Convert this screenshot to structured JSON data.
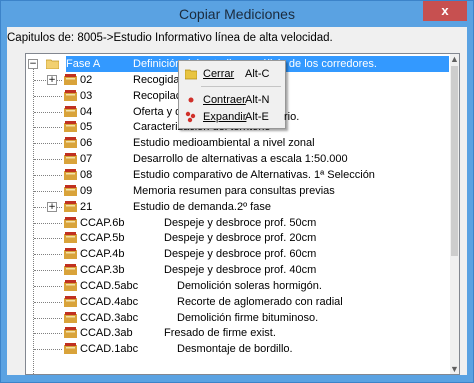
{
  "window": {
    "title": "Copiar Mediciones",
    "close_label": "x"
  },
  "caption": "Capitulos de: 8005->Estudio Informativo línea de alta velocidad.",
  "tree": [
    {
      "code": "Fase A",
      "desc": "Definición del estudio y análisis de los corredores.",
      "level": 0,
      "expander": "−",
      "icon": "folder",
      "selected": true
    },
    {
      "code": "02",
      "desc": "Recogida y",
      "level": 1,
      "expander": "+",
      "icon": "book"
    },
    {
      "code": "03",
      "desc": "Recopilació",
      "level": 1,
      "icon": "book"
    },
    {
      "code": "04",
      "desc": "Oferta y de",
      "level": 1,
      "icon": "book"
    },
    {
      "code": "05",
      "desc": "Caracterización del territorio",
      "level": 1,
      "icon": "book"
    },
    {
      "code": "06",
      "desc": "Estudio medioambiental a nivel zonal",
      "level": 1,
      "icon": "book"
    },
    {
      "code": "07",
      "desc": "Desarrollo de alternativas a escala 1:50.000",
      "level": 1,
      "icon": "book"
    },
    {
      "code": "08",
      "desc": "Estudio comparativo de Alternativas. 1ª Selección",
      "level": 1,
      "icon": "book"
    },
    {
      "code": "09",
      "desc": "Memoria resumen para consultas previas",
      "level": 1,
      "icon": "book"
    },
    {
      "code": "21",
      "desc": "Estudio de demanda.2º fase",
      "level": 1,
      "expander": "+",
      "icon": "book"
    },
    {
      "code": "CCAP.6b",
      "desc": "Despeje y desbroce prof. 50cm",
      "level": 1,
      "icon": "book",
      "indent": 1
    },
    {
      "code": "CCAP.5b",
      "desc": "Despeje y desbroce prof. 20cm",
      "level": 1,
      "icon": "book",
      "indent": 1
    },
    {
      "code": "CCAP.4b",
      "desc": "Despeje y desbroce prof. 60cm",
      "level": 1,
      "icon": "book",
      "indent": 1
    },
    {
      "code": "CCAP.3b",
      "desc": "Despeje y desbroce prof. 40cm",
      "level": 1,
      "icon": "book",
      "indent": 1
    },
    {
      "code": "CCAD.5abc",
      "desc": "Demolición soleras hormigón.",
      "level": 1,
      "icon": "book",
      "indent": 2
    },
    {
      "code": "CCAD.4abc",
      "desc": "Recorte de aglomerado con radial",
      "level": 1,
      "icon": "book",
      "indent": 2
    },
    {
      "code": "CCAD.3abc",
      "desc": "Demolición firme bituminoso.",
      "level": 1,
      "icon": "book",
      "indent": 2
    },
    {
      "code": "CCAD.3ab",
      "desc": "Fresado de firme exist.",
      "level": 1,
      "icon": "book",
      "indent": 1
    },
    {
      "code": "CCAD.1abc",
      "desc": "Desmontaje de bordillo.",
      "level": 1,
      "icon": "book",
      "indent": 2
    }
  ],
  "hidden_desc_tail": "rio.",
  "context_menu": {
    "items": [
      {
        "label": "Cerrar",
        "shortcut": "Alt-C",
        "icon": "folder-icon"
      },
      {
        "label": "Contraer",
        "shortcut": "Alt-N",
        "icon": "red-dot-icon"
      },
      {
        "label": "Expandir",
        "shortcut": "Alt-E",
        "icon": "expand-icon"
      }
    ]
  },
  "colors": {
    "title_bar": "#5aa2e2",
    "selection": "#3399ff",
    "close": "#c75050"
  }
}
